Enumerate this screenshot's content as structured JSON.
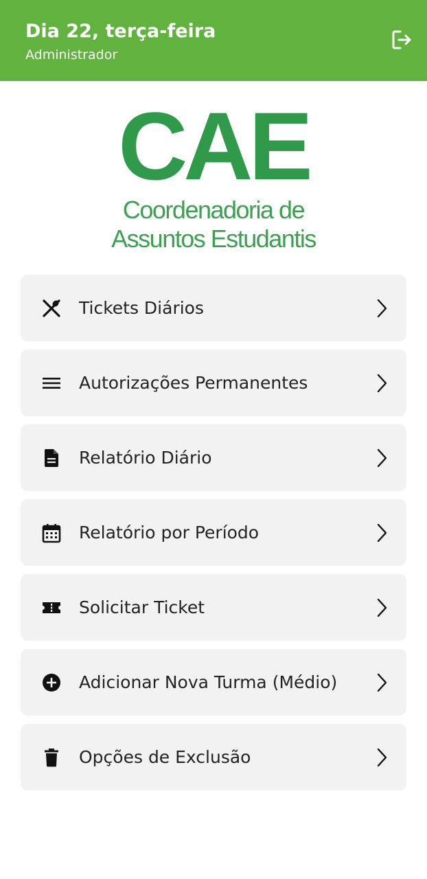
{
  "header": {
    "title": "Dia 22, terça-feira",
    "subtitle": "Administrador",
    "logout_icon": "logout-icon",
    "background": "#62b23f"
  },
  "logo": {
    "acronym": "CAE",
    "line1": "Coordenadoria de",
    "line2": "Assuntos Estudantis",
    "color": "#2f9a4a"
  },
  "menu": {
    "items": [
      {
        "label": "Tickets Diários",
        "icon": "utensils-icon"
      },
      {
        "label": "Autorizações Permanentes",
        "icon": "list-icon"
      },
      {
        "label": "Relatório Diário",
        "icon": "document-icon"
      },
      {
        "label": "Relatório por Período",
        "icon": "calendar-icon"
      },
      {
        "label": "Solicitar Ticket",
        "icon": "ticket-icon"
      },
      {
        "label": "Adicionar Nova Turma (Médio)",
        "icon": "add-circle-icon"
      },
      {
        "label": "Opções de Exclusão",
        "icon": "trash-icon"
      }
    ]
  }
}
